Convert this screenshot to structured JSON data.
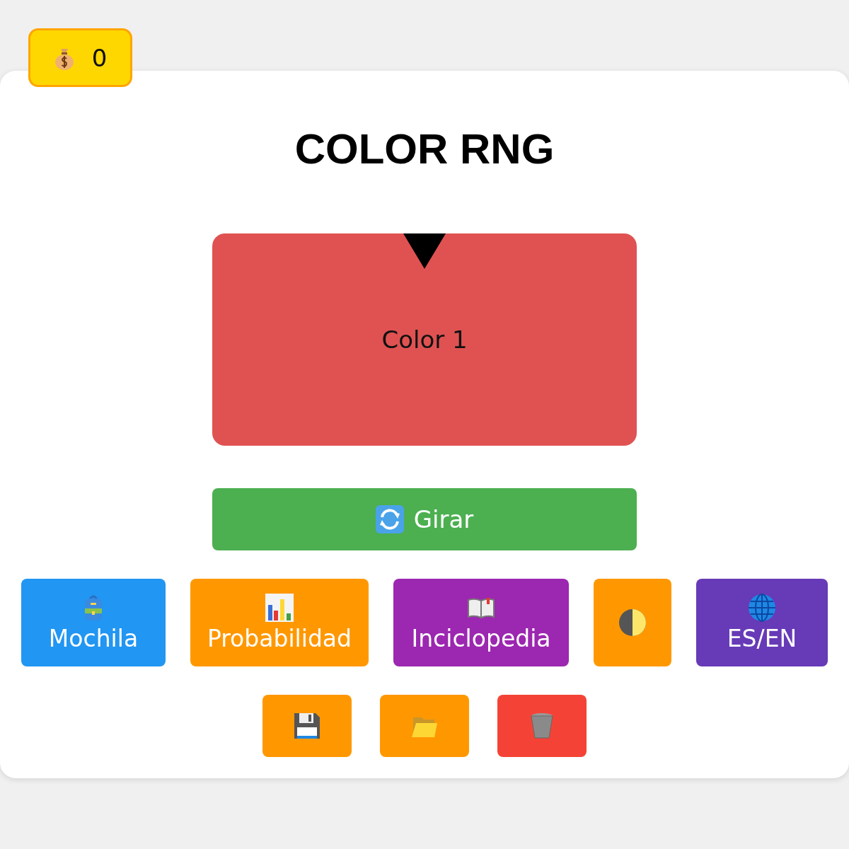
{
  "coins": {
    "value": "0"
  },
  "title": "COLOR RNG",
  "wheel": {
    "label": "Color 1",
    "color": "#e05252"
  },
  "spin_button": {
    "label": "Girar"
  },
  "menu_buttons": [
    {
      "label": "Mochila",
      "color": "#2196f3"
    },
    {
      "label": "Probabilidad",
      "color": "#ff9800"
    },
    {
      "label": "Inciclopedia",
      "color": "#9c27b0"
    },
    {
      "color": "#ff9800"
    },
    {
      "label": "ES/EN",
      "color": "#673ab7"
    }
  ],
  "file_buttons": [
    {
      "color": "#ff9800"
    },
    {
      "color": "#ff9800"
    },
    {
      "color": "#f44336"
    }
  ]
}
